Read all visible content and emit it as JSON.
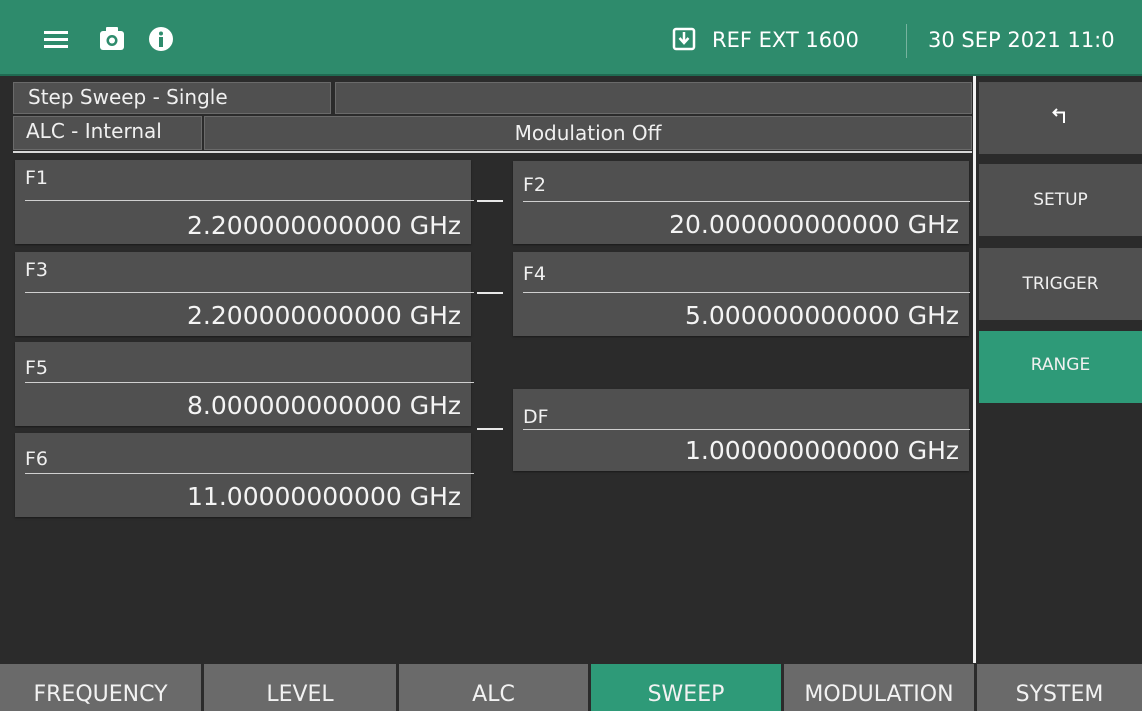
{
  "topbar": {
    "icons": [
      "menu-icon",
      "camera-icon",
      "info-icon",
      "ref-download-icon"
    ],
    "ref_text": "REF EXT 1600",
    "datetime": "30 SEP 2021 11:0",
    "color": "#2e8b6c"
  },
  "status": {
    "sweep_mode": "Step Sweep - Single",
    "alc_mode": "ALC - Internal",
    "modulation": "Modulation Off"
  },
  "params": {
    "f1": {
      "label": "F1",
      "value": "2.200000000000 GHz"
    },
    "f2": {
      "label": "F2",
      "value": "20.000000000000 GHz"
    },
    "f3": {
      "label": "F3",
      "value": "2.200000000000 GHz"
    },
    "f4": {
      "label": "F4",
      "value": "5.000000000000 GHz"
    },
    "f5": {
      "label": "F5",
      "value": "8.000000000000 GHz"
    },
    "f6": {
      "label": "F6",
      "value": "11.00000000000 GHz"
    },
    "df": {
      "label": "DF",
      "value": "1.000000000000 GHz"
    }
  },
  "side_menu": {
    "back_icon": "return-arrow-icon",
    "items": [
      "SETUP",
      "TRIGGER",
      "RANGE"
    ],
    "active": "RANGE"
  },
  "tabs": {
    "items": [
      "FREQUENCY",
      "LEVEL",
      "ALC",
      "SWEEP",
      "MODULATION",
      "SYSTEM"
    ],
    "active": "SWEEP"
  },
  "colors": {
    "accent": "#2e9a78",
    "panel": "#505050",
    "background": "#2b2b2b",
    "tab": "#6a6a6a"
  }
}
